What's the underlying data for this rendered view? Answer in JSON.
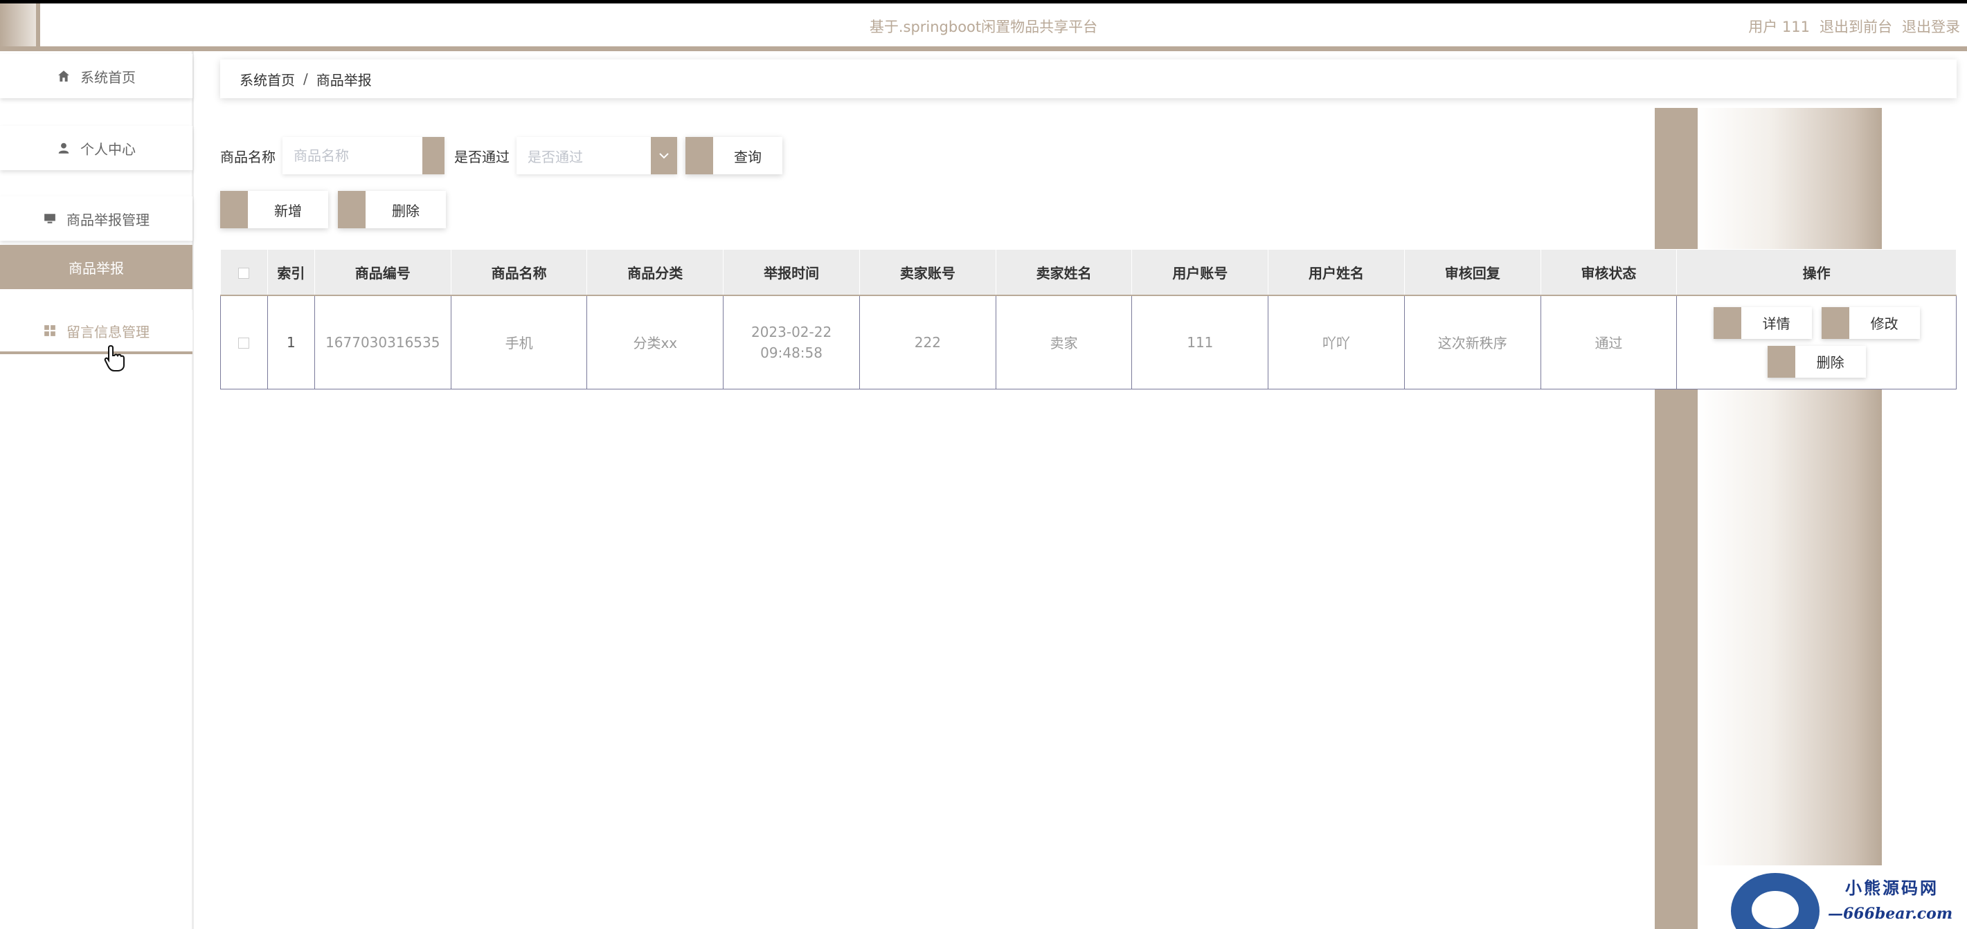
{
  "header": {
    "title": "基于.springboot闲置物品共享平台",
    "user": "用户 111",
    "to_front": "退出到前台",
    "logout": "退出登录"
  },
  "sidebar": {
    "items": [
      {
        "label": "系统首页",
        "icon": "home-icon"
      },
      {
        "label": "个人中心",
        "icon": "user-icon"
      },
      {
        "label": "商品举报管理",
        "icon": "monitor-icon"
      },
      {
        "label": "商品举报",
        "icon": ""
      },
      {
        "label": "留言信息管理",
        "icon": "grid-icon"
      }
    ]
  },
  "breadcrumb": {
    "home": "系统首页",
    "separator": "/",
    "current": "商品举报"
  },
  "search": {
    "name_label": "商品名称",
    "name_placeholder": "商品名称",
    "pass_label": "是否通过",
    "pass_placeholder": "是否通过",
    "query_button": "查询"
  },
  "actions": {
    "add": "新增",
    "delete": "删除"
  },
  "table": {
    "headers": [
      "索引",
      "商品编号",
      "商品名称",
      "商品分类",
      "举报时间",
      "卖家账号",
      "卖家姓名",
      "用户账号",
      "用户姓名",
      "审核回复",
      "审核状态",
      "操作"
    ],
    "rows": [
      {
        "index": "1",
        "code": "1677030316535",
        "name": "手机",
        "category": "分类xx",
        "time": "2023-02-22 09:48:58",
        "seller_account": "222",
        "seller_name": "卖家",
        "user_account": "111",
        "user_name": "吖吖",
        "reply": "这次新秩序",
        "status": "通过",
        "ops": {
          "detail": "详情",
          "edit": "修改",
          "delete": "删除"
        }
      }
    ]
  },
  "watermark": {
    "line1": "小熊源码网",
    "line2": "—666bear.com—"
  },
  "colors": {
    "accent": "#b9a998"
  }
}
